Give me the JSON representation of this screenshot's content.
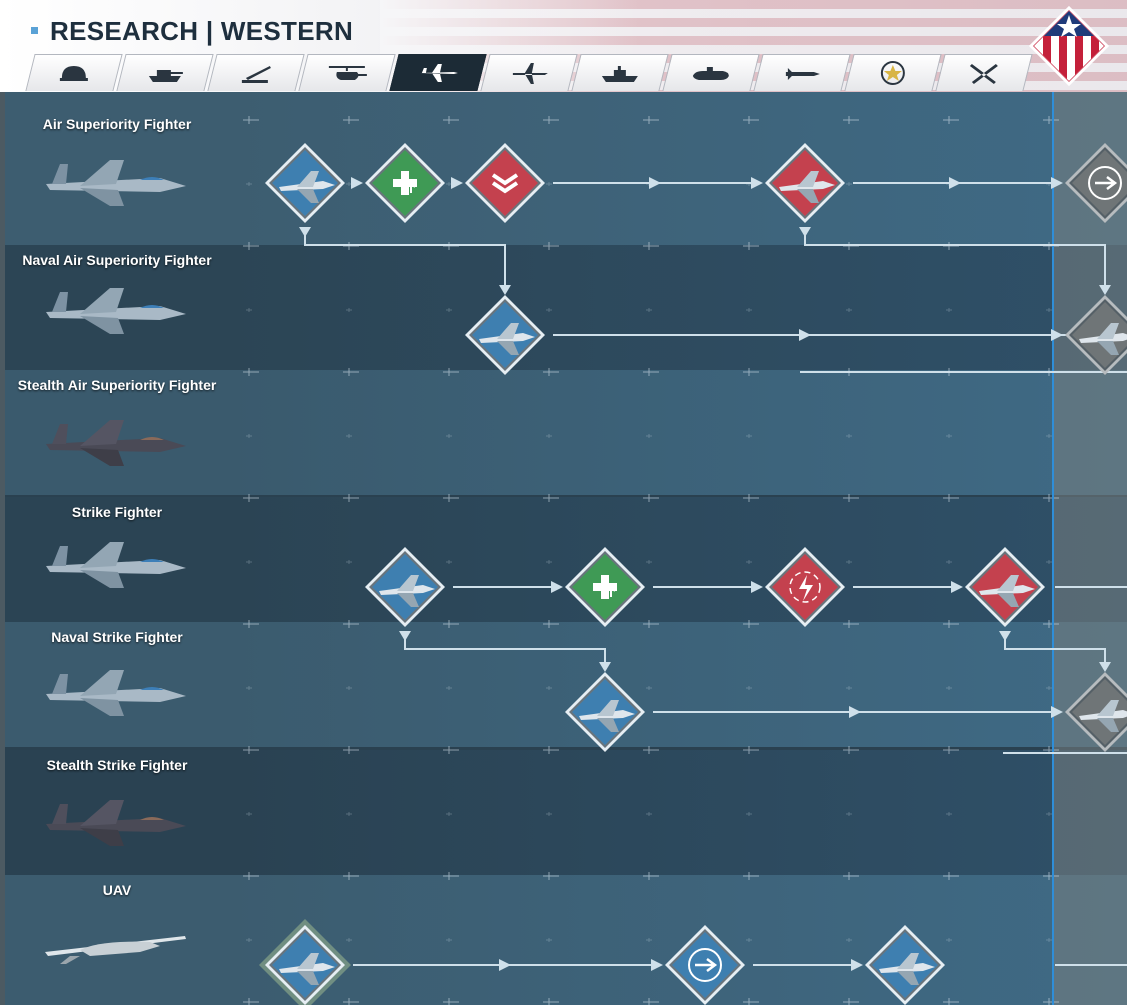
{
  "header": {
    "title": "RESEARCH | WESTERN",
    "faction_emblem": "us-flag-star-emblem",
    "accent_color": "#5aa2d6"
  },
  "tabs": [
    {
      "icon": "helmet-icon",
      "name": "infantry",
      "active": false
    },
    {
      "icon": "tank-icon",
      "name": "armor",
      "active": false
    },
    {
      "icon": "missile-launcher-icon",
      "name": "artillery",
      "active": false
    },
    {
      "icon": "helicopter-icon",
      "name": "helicopters",
      "active": false
    },
    {
      "icon": "fighter-jet-icon",
      "name": "fighters",
      "active": true
    },
    {
      "icon": "bomber-icon",
      "name": "bombers",
      "active": false
    },
    {
      "icon": "ship-icon",
      "name": "ships",
      "active": false
    },
    {
      "icon": "submarine-icon",
      "name": "submarines",
      "active": false
    },
    {
      "icon": "missile-icon",
      "name": "missiles",
      "active": false
    },
    {
      "icon": "star-badge-icon",
      "name": "officers",
      "active": false
    },
    {
      "icon": "crossed-swords-icon",
      "name": "special",
      "active": false
    }
  ],
  "rows": [
    {
      "label": "Air Superiority Fighter",
      "unit_icon": "air-superiority-fighter-jet"
    },
    {
      "label": "Naval Air Superiority Fighter",
      "unit_icon": "naval-air-superiority-fighter-jet"
    },
    {
      "label": "Stealth Air Superiority Fighter",
      "unit_icon": "stealth-air-superiority-fighter-jet"
    },
    {
      "label": "Strike Fighter",
      "unit_icon": "strike-fighter-jet"
    },
    {
      "label": "Naval Strike Fighter",
      "unit_icon": "naval-strike-fighter-jet"
    },
    {
      "label": "Stealth Strike Fighter",
      "unit_icon": "stealth-strike-fighter-jet"
    },
    {
      "label": "UAV",
      "unit_icon": "uav-drone"
    }
  ],
  "research_nodes": [
    {
      "row": 0,
      "col": 0,
      "kind": "unit",
      "state": "researched"
    },
    {
      "row": 0,
      "col": 1,
      "kind": "upgrade-health",
      "state": "researched"
    },
    {
      "row": 0,
      "col": 2,
      "kind": "upgrade-rank",
      "state": "unlocked"
    },
    {
      "row": 0,
      "col": 5,
      "kind": "unit",
      "state": "unlocked"
    },
    {
      "row": 0,
      "col": 8,
      "kind": "upgrade-speed",
      "state": "locked"
    },
    {
      "row": 1,
      "col": 2,
      "kind": "unit",
      "state": "researched"
    },
    {
      "row": 1,
      "col": 8,
      "kind": "unit",
      "state": "locked"
    },
    {
      "row": 3,
      "col": 1,
      "kind": "unit",
      "state": "researched"
    },
    {
      "row": 3,
      "col": 3,
      "kind": "upgrade-health",
      "state": "researched"
    },
    {
      "row": 3,
      "col": 5,
      "kind": "upgrade-damage",
      "state": "unlocked"
    },
    {
      "row": 3,
      "col": 7,
      "kind": "unit",
      "state": "unlocked"
    },
    {
      "row": 4,
      "col": 3,
      "kind": "unit",
      "state": "researched"
    },
    {
      "row": 4,
      "col": 8,
      "kind": "unit",
      "state": "locked"
    },
    {
      "row": 6,
      "col": 0,
      "kind": "unit",
      "state": "selected"
    },
    {
      "row": 6,
      "col": 4,
      "kind": "upgrade-speed",
      "state": "researched"
    },
    {
      "row": 6,
      "col": 6,
      "kind": "unit",
      "state": "researched"
    }
  ],
  "colors": {
    "researched": "#3e7fb0",
    "upgrade_health": "#3f9a55",
    "unlocked_red": "#c4414e",
    "locked": "#6f7577",
    "connector": "#cfe0ea",
    "divider": "#2f8ed8"
  }
}
